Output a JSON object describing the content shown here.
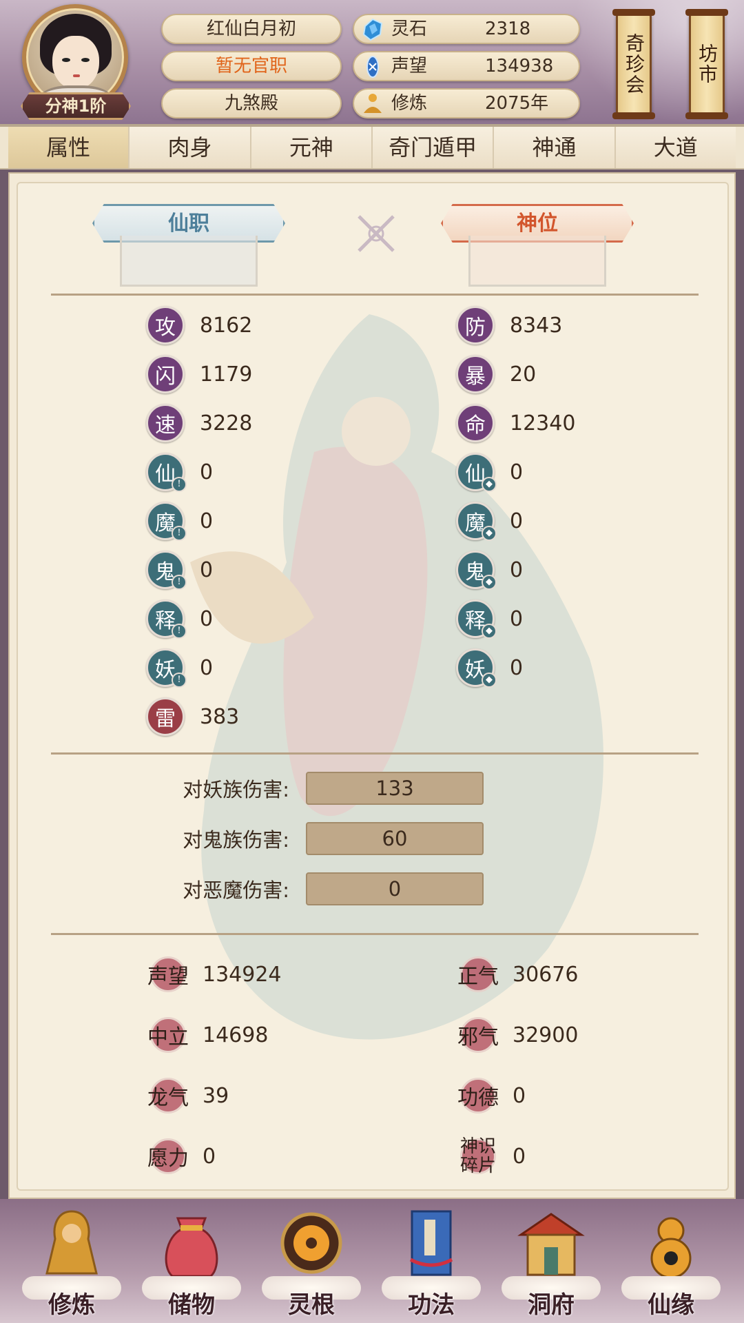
{
  "header": {
    "rank_badge": "分神1阶",
    "name": "红仙白月初",
    "title": "暂无官职",
    "faction": "九煞殿",
    "resources": [
      {
        "icon": "spirit-stone-icon",
        "label": "灵石",
        "value": "2318"
      },
      {
        "icon": "reputation-icon",
        "label": "声望",
        "value": "134938"
      },
      {
        "icon": "cultivation-icon",
        "label": "修炼",
        "value": "2075年"
      }
    ],
    "side_buttons": [
      "奇珍会",
      "坊市"
    ]
  },
  "tabs": [
    "属性",
    "肉身",
    "元神",
    "奇门遁甲",
    "神通",
    "大道"
  ],
  "frames": {
    "left": "仙职",
    "right": "神位"
  },
  "stats_left": [
    {
      "label": "攻",
      "value": "8162"
    },
    {
      "label": "闪",
      "value": "1179"
    },
    {
      "label": "速",
      "value": "3228"
    },
    {
      "label": "仙",
      "value": "0"
    },
    {
      "label": "魔",
      "value": "0"
    },
    {
      "label": "鬼",
      "value": "0"
    },
    {
      "label": "释",
      "value": "0"
    },
    {
      "label": "妖",
      "value": "0"
    },
    {
      "label": "雷",
      "value": "383"
    }
  ],
  "stats_right": [
    {
      "label": "防",
      "value": "8343"
    },
    {
      "label": "暴",
      "value": "20"
    },
    {
      "label": "命",
      "value": "12340"
    },
    {
      "label": "仙",
      "value": "0"
    },
    {
      "label": "魔",
      "value": "0"
    },
    {
      "label": "鬼",
      "value": "0"
    },
    {
      "label": "释",
      "value": "0"
    },
    {
      "label": "妖",
      "value": "0"
    }
  ],
  "damage": [
    {
      "label": "对妖族伤害:",
      "value": "133"
    },
    {
      "label": "对鬼族伤害:",
      "value": "60"
    },
    {
      "label": "对恶魔伤害:",
      "value": "0"
    }
  ],
  "reputation_left": [
    {
      "label": "声望",
      "value": "134924"
    },
    {
      "label": "中立",
      "value": "14698"
    },
    {
      "label": "龙气",
      "value": "39"
    },
    {
      "label": "愿力",
      "value": "0"
    }
  ],
  "reputation_right": [
    {
      "label": "正气",
      "value": "30676"
    },
    {
      "label": "邪气",
      "value": "32900"
    },
    {
      "label": "功德",
      "value": "0"
    },
    {
      "label": "神识碎片",
      "value": "0"
    }
  ],
  "bottom_nav": [
    {
      "label": "修炼",
      "icon": "meditating-monk-icon"
    },
    {
      "label": "储物",
      "icon": "storage-bag-icon"
    },
    {
      "label": "灵根",
      "icon": "spirit-root-icon"
    },
    {
      "label": "功法",
      "icon": "scripture-book-icon"
    },
    {
      "label": "洞府",
      "icon": "cave-palace-icon"
    },
    {
      "label": "仙缘",
      "icon": "gourd-icon"
    }
  ],
  "colors": {
    "attack_purple": "#6f3f78",
    "element_teal": "#3d6e78",
    "thunder_red": "#9a3e46",
    "title_orange": "#e0641a",
    "panel_bg": "#f6efdf"
  }
}
